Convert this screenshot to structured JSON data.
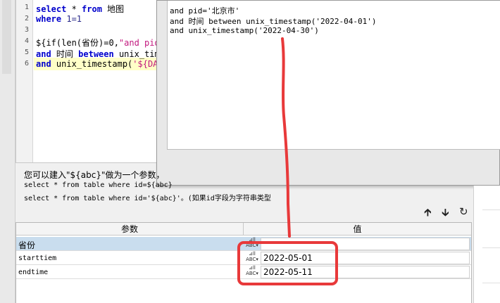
{
  "editor": {
    "lines": [
      {
        "no": "1",
        "text": "select * from 地图"
      },
      {
        "no": "2",
        "text": "where 1=1"
      },
      {
        "no": "3",
        "text": ""
      },
      {
        "no": "4",
        "text": "${if(len(省份)=0,\"and pid"
      },
      {
        "no": "5",
        "text": "and 时间 between unix_tim"
      },
      {
        "no": "6",
        "text": "and  unix_timestamp('${DA"
      }
    ]
  },
  "preview": {
    "lines": [
      "and pid='北京市'",
      "and 时间 between unix_timestamp('2022-04-01')",
      "and  unix_timestamp('2022-04-30')"
    ]
  },
  "hint": {
    "title": "您可以建入\"${abc}\"做为一个参数，",
    "line1": "select * from table where id=${abc}",
    "line2": "select * from table where id='${abc}'。(如果id字段为字符串类型"
  },
  "toolbar": {
    "up_icon": "arrow-up-icon",
    "down_icon": "arrow-down-icon",
    "refresh_icon": "refresh-icon"
  },
  "params_table": {
    "headers": [
      "参数",
      "值"
    ],
    "rows": [
      {
        "name": "省份",
        "type": "ABC",
        "value": ""
      },
      {
        "name": "starttiem",
        "type": "ABC",
        "value": "2022-05-01"
      },
      {
        "name": "endtime",
        "type": "ABC",
        "value": "2022-05-11"
      }
    ]
  },
  "colors": {
    "annotation_red": "#e8393a",
    "selected_row": "#c9ddee",
    "keyword_blue": "#0000cc",
    "string_magenta": "#c2187e"
  }
}
